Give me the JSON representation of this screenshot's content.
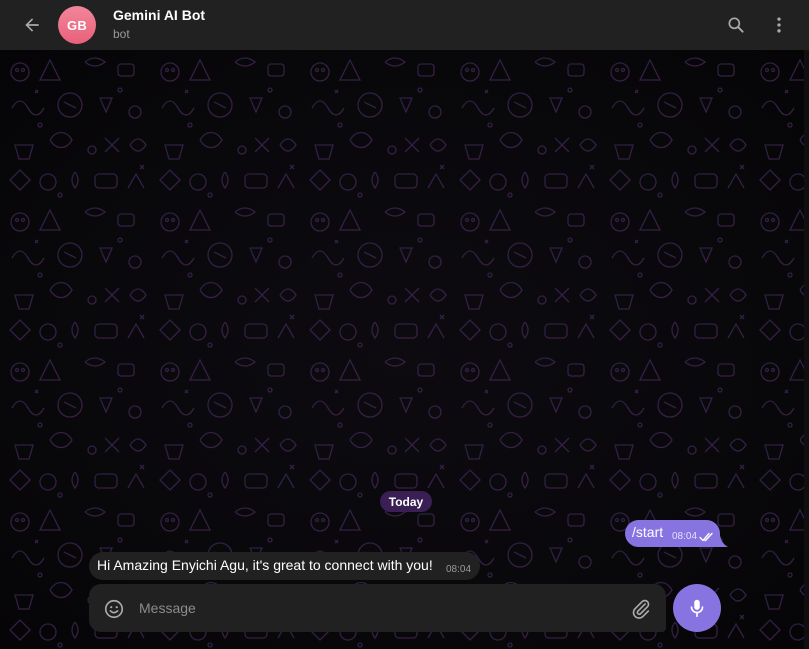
{
  "header": {
    "avatar_initials": "GB",
    "title": "Gemini AI Bot",
    "subtitle": "bot",
    "icons": {
      "back": "arrow-back-icon",
      "search": "search-icon",
      "more": "more-vertical-icon"
    }
  },
  "chat": {
    "date_separator": "Today",
    "messages": [
      {
        "direction": "outgoing",
        "text": "/start",
        "time": "08:04",
        "status": "read"
      },
      {
        "direction": "incoming",
        "text": "Hi Amazing Enyichi Agu, it's great to connect with you!",
        "time": "08:04"
      }
    ]
  },
  "composer": {
    "placeholder": "Message",
    "value": "",
    "icons": {
      "emoji": "smiley-icon",
      "attach": "paperclip-icon",
      "mic": "microphone-icon"
    }
  },
  "colors": {
    "accent": "#8774e1",
    "header_bg": "#212121",
    "incoming_bubble": "#212121",
    "avatar": "#ea7086",
    "date_pill": "#3a1f55"
  }
}
